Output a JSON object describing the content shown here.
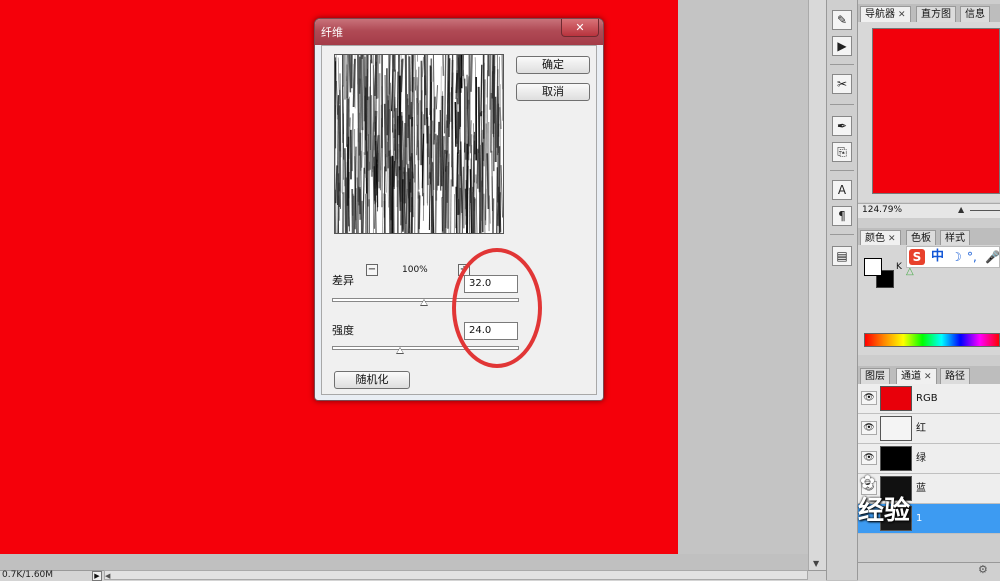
{
  "status": {
    "doc_info": "0.7K/1.60M",
    "arrow": "▶"
  },
  "dialog": {
    "title": "纤维",
    "close_glyph": "✕",
    "ok_label": "确定",
    "cancel_label": "取消",
    "zoom_minus": "−",
    "zoom_plus": "+",
    "zoom": "100%",
    "variance_label": "差异",
    "variance_value": "32.0",
    "variance": 32.0,
    "strength_label": "强度",
    "strength_value": "24.0",
    "strength": 24.0,
    "randomize_label": "随机化"
  },
  "tools": [
    {
      "name": "history-brush-icon",
      "glyph": "✎"
    },
    {
      "name": "action-play-icon",
      "glyph": "▶"
    },
    {
      "name": "tool-preset-icon",
      "glyph": "✂"
    },
    {
      "name": "brush-icon",
      "glyph": "✒"
    },
    {
      "name": "clone-source-icon",
      "glyph": "⎘"
    },
    {
      "name": "character-icon",
      "glyph": "A"
    },
    {
      "name": "paragraph-icon",
      "glyph": "¶"
    },
    {
      "name": "layer-comps-icon",
      "glyph": "▤"
    }
  ],
  "navigator": {
    "tabs": [
      {
        "label": "导航器",
        "close": "✕"
      },
      {
        "label": "直方图"
      },
      {
        "label": "信息"
      }
    ],
    "zoom": "124.79%",
    "zoom_small_icon": "▲"
  },
  "color": {
    "tabs": [
      {
        "label": "颜色",
        "close": "✕"
      },
      {
        "label": "色板"
      },
      {
        "label": "样式"
      }
    ],
    "k_label": "K",
    "warning_glyph": "△",
    "fg": "#ffffff",
    "bg": "#000000"
  },
  "ime": {
    "logo": "S",
    "lang": "中",
    "moon": "☽",
    "punct": "°,",
    "mic": "🎤"
  },
  "channels": {
    "tabs": [
      {
        "label": "图层"
      },
      {
        "label": "通道",
        "close": "✕"
      },
      {
        "label": "路径"
      }
    ],
    "eye_glyph": "👁",
    "rows": [
      {
        "label": "RGB",
        "thumb": "#e8000a"
      },
      {
        "label": "红",
        "thumb": "#f4f4f4"
      },
      {
        "label": "绿",
        "thumb": "#000000"
      },
      {
        "label": "蓝",
        "thumb": "#111111"
      },
      {
        "label": "1",
        "thumb": "#1a1a1a"
      }
    ],
    "settings_glyph": "⚙"
  },
  "watermark": {
    "text": "经验",
    "paw": "✿"
  },
  "colors": {
    "canvas": "#f5000a",
    "title_bar": "#b04a55",
    "annotation": "#e13636",
    "selection": "#3d9bf2"
  }
}
